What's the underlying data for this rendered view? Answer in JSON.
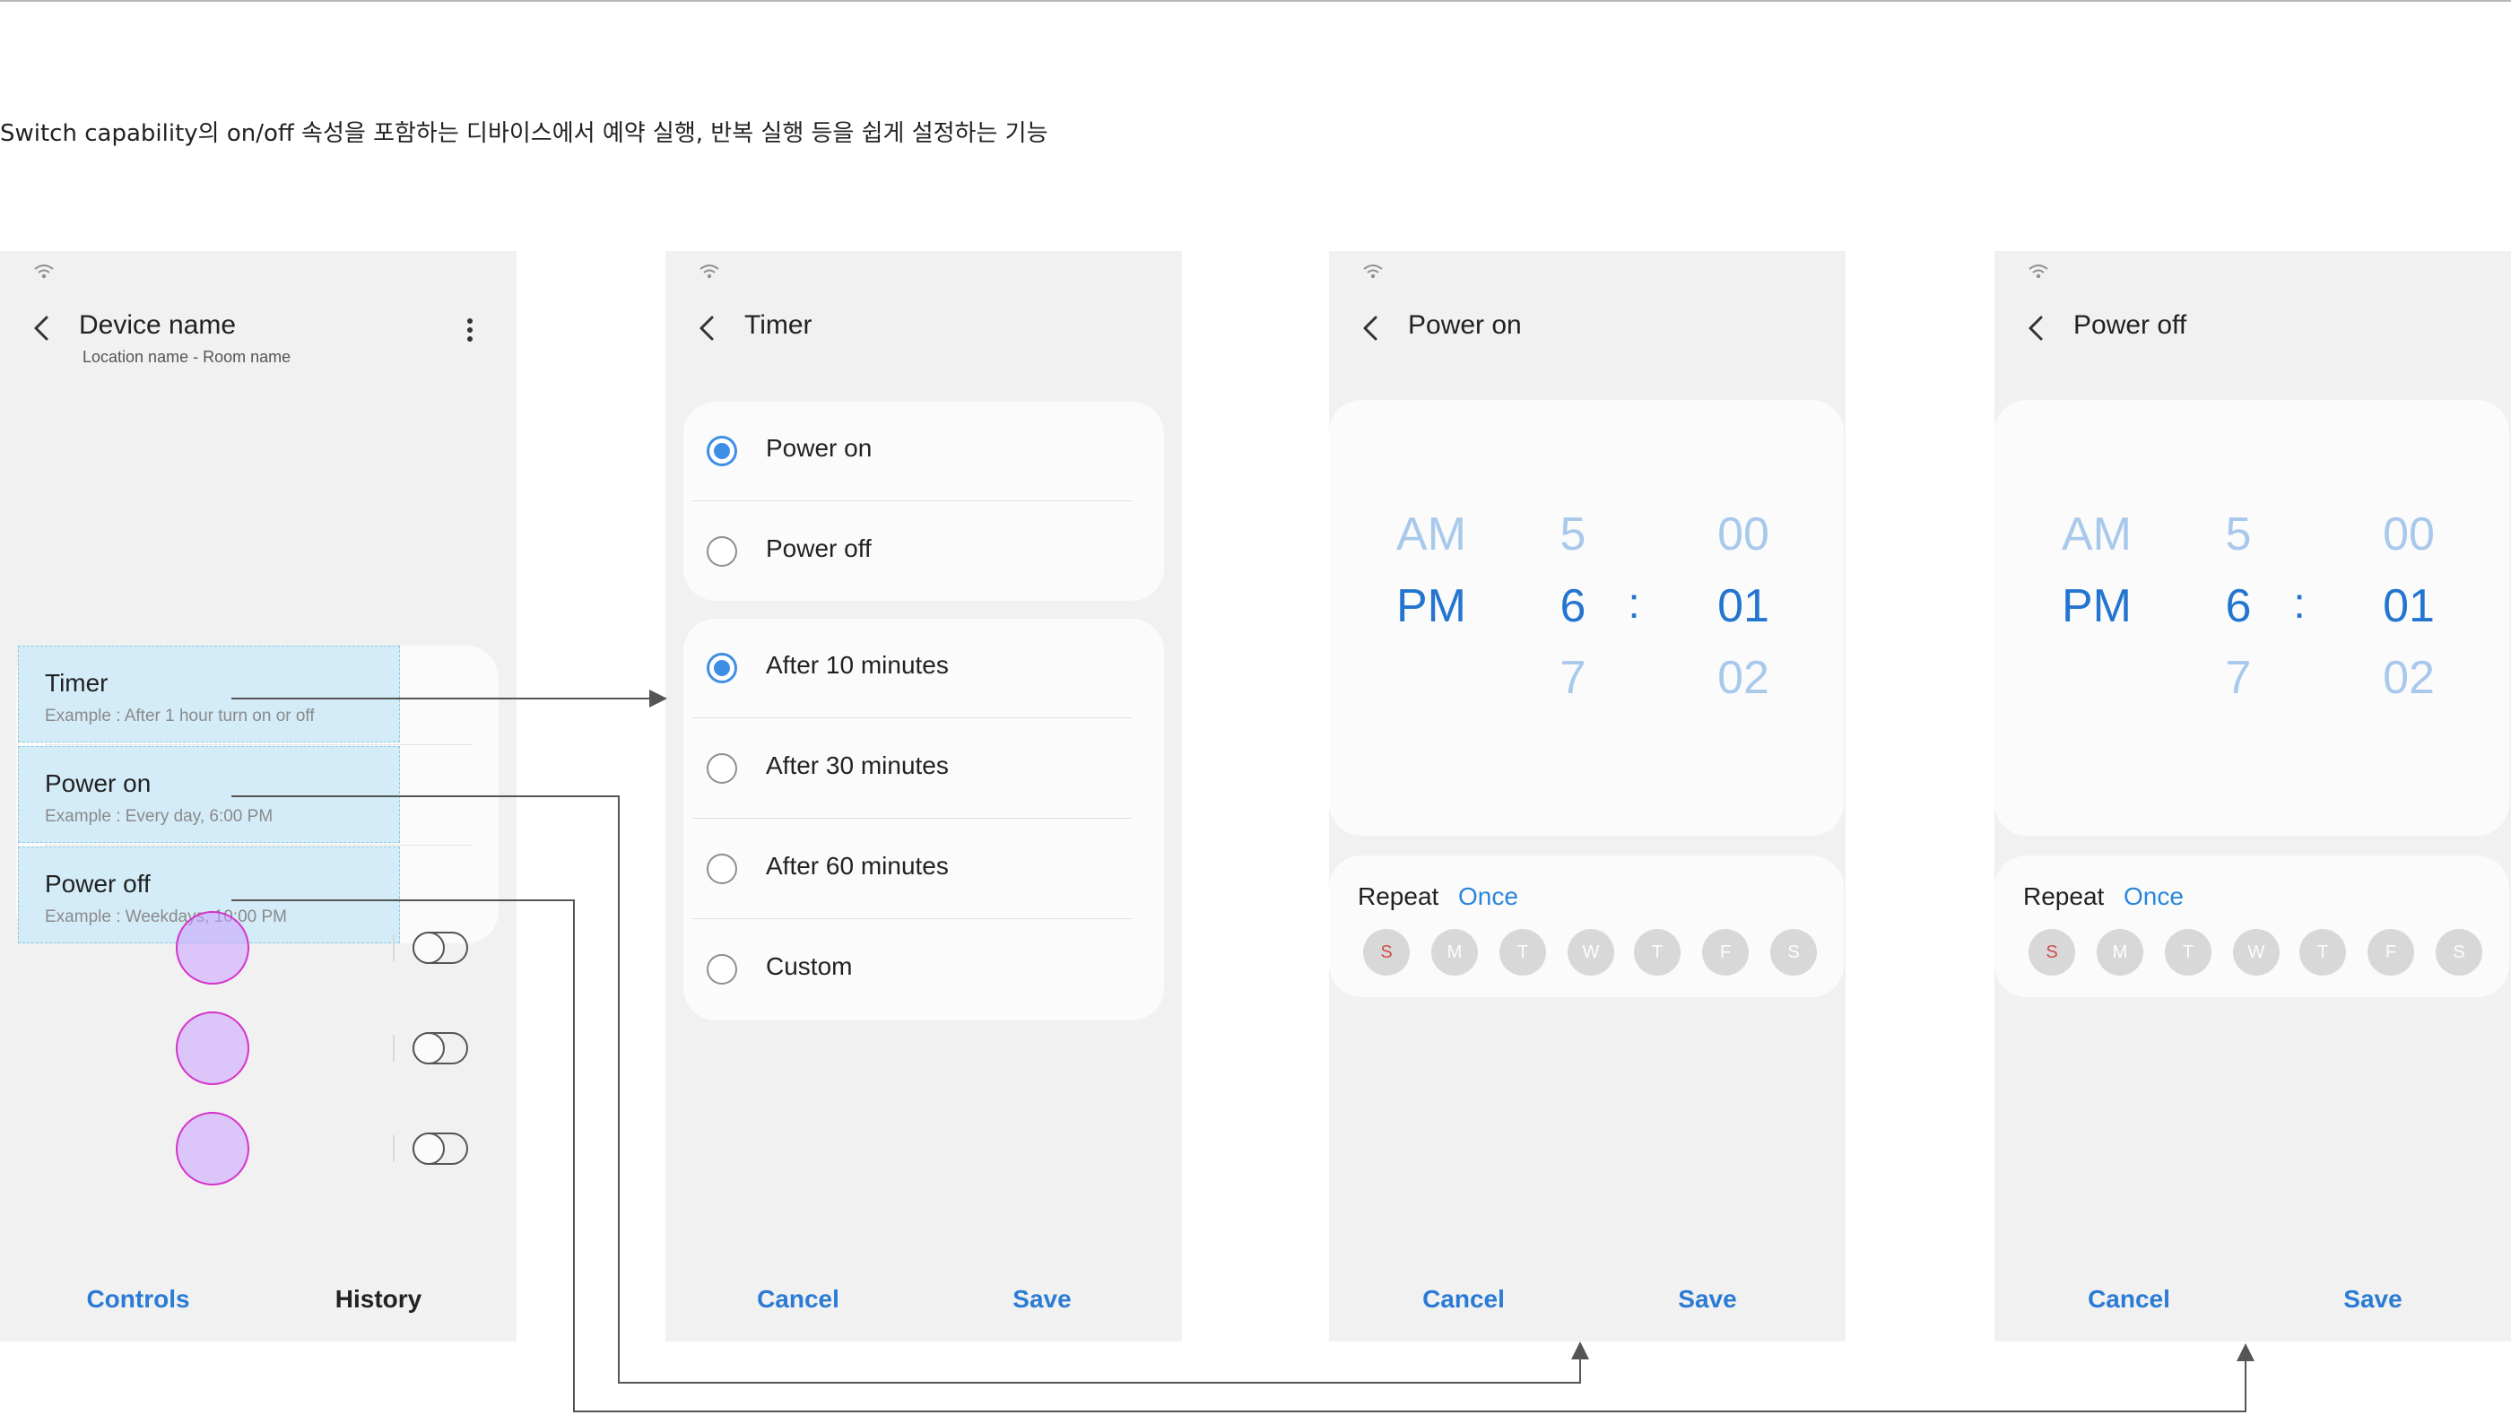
{
  "caption": "Switch capability의 on/off 속성을 포함하는 디바이스에서 예약 실행, 반복 실행 등을 쉽게 설정하는 기능",
  "screen1": {
    "title": "Device name",
    "subtitle": "Location name - Room name",
    "rows": [
      {
        "title": "Timer",
        "example": "Example : After 1 hour turn on or off"
      },
      {
        "title": "Power on",
        "example": "Example : Every day, 6:00 PM"
      },
      {
        "title": "Power off",
        "example": "Example : Weekdays, 10:00 PM"
      }
    ],
    "tabs": {
      "controls": "Controls",
      "history": "History"
    }
  },
  "screen2": {
    "title": "Timer",
    "power_options": [
      {
        "label": "Power on",
        "selected": true
      },
      {
        "label": "Power off",
        "selected": false
      }
    ],
    "time_options": [
      {
        "label": "After 10 minutes",
        "selected": true
      },
      {
        "label": "After 30 minutes",
        "selected": false
      },
      {
        "label": "After 60 minutes",
        "selected": false
      },
      {
        "label": "Custom",
        "selected": false
      }
    ],
    "cancel": "Cancel",
    "save": "Save"
  },
  "screen3": {
    "title": "Power on",
    "picker": {
      "ampm": [
        "AM",
        "PM"
      ],
      "hours": [
        "5",
        "6",
        "7"
      ],
      "colon": ":",
      "minutes": [
        "00",
        "01",
        "02"
      ]
    },
    "repeat_label": "Repeat",
    "repeat_value": "Once",
    "days": [
      "S",
      "M",
      "T",
      "W",
      "T",
      "F",
      "S"
    ],
    "cancel": "Cancel",
    "save": "Save"
  },
  "screen4": {
    "title": "Power off",
    "picker": {
      "ampm": [
        "AM",
        "PM"
      ],
      "hours": [
        "5",
        "6",
        "7"
      ],
      "colon": ":",
      "minutes": [
        "00",
        "01",
        "02"
      ]
    },
    "repeat_label": "Repeat",
    "repeat_value": "Once",
    "days": [
      "S",
      "M",
      "T",
      "W",
      "T",
      "F",
      "S"
    ],
    "cancel": "Cancel",
    "save": "Save"
  },
  "colors": {
    "accent": "#2a7bd6",
    "highlight": "#d4ecf8",
    "touch_indicator": "#d533c9",
    "screen_bg": "#f1f1f1"
  },
  "icons": [
    "wifi-icon",
    "back-arrow-icon",
    "more-vertical-icon"
  ]
}
